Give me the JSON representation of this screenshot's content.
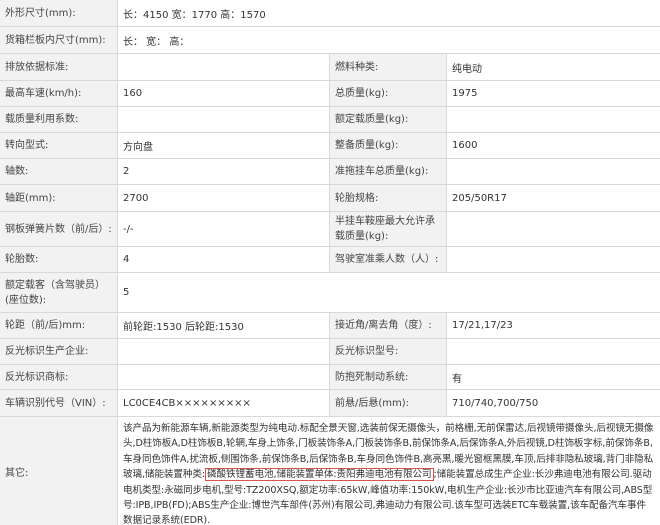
{
  "rows": [
    {
      "label": "外形尺寸(mm):",
      "value": "长：4150 宽：1770 高：1570"
    },
    {
      "label": "货箱栏板内尺寸(mm):",
      "value": "长： 宽： 高："
    },
    {
      "l1": "排放依据标准:",
      "v1": "",
      "l2": "燃料种类:",
      "v2": "纯电动"
    },
    {
      "l1": "最高车速(km/h):",
      "v1": "160",
      "l2": "总质量(kg):",
      "v2": "1975"
    },
    {
      "l1": "载质量利用系数:",
      "v1": "",
      "l2": "额定载质量(kg):",
      "v2": ""
    },
    {
      "l1": "转向型式:",
      "v1": "方向盘",
      "l2": "整备质量(kg):",
      "v2": "1600"
    },
    {
      "l1": "轴数:",
      "v1": "2",
      "l2": "准拖挂车总质量(kg):",
      "v2": ""
    },
    {
      "l1": "轴距(mm):",
      "v1": "2700",
      "l2": "轮胎规格:",
      "v2": "205/50R17"
    },
    {
      "l1": "钢板弹簧片数（前/后）:",
      "v1": "-/-",
      "l2": "半挂车鞍座最大允许承载质量(kg):",
      "v2": ""
    },
    {
      "l1": "轮胎数:",
      "v1": "4",
      "l2": "驾驶室准乘人数（人）:",
      "v2": ""
    },
    {
      "label": "额定载客（含驾驶员）(座位数):",
      "value": "5"
    },
    {
      "l1": "轮距（前/后)mm:",
      "v1": "前轮距:1530 后轮距:1530",
      "l2": "接近角/离去角（度）:",
      "v2": "17/21,17/23"
    },
    {
      "l1": "反光标识生产企业:",
      "v1": "",
      "l2": "反光标识型号:",
      "v2": ""
    },
    {
      "l1": "反光标识商标:",
      "v1": "",
      "l2": "防抱死制动系统:",
      "v2": "有"
    },
    {
      "l1": "车辆识别代号（VIN）:",
      "v1": "LC0CE4CB×××××××××",
      "l2": "前悬/后悬(mm):",
      "v2": "710/740,700/750"
    }
  ],
  "other": {
    "label": "其它:",
    "text_before": "该产品为新能源车辆,新能源类型为纯电动.标配全景天窗,选装前保无摄像头，前格栅,无前保雷达,后视镜带摄像头,后视镜无摄像头,D柱饰板A,D柱饰板B,轮辋,车身上饰条,门板装饰条A,门板装饰条B,前保饰条A,后保饰条A,外后视镜,D柱饰板字标,前保饰条B,车身同色饰件A,扰流板,侧围饰条,前保饰条B,后保饰条B,车身同色饰件B,高亮黑,暖光窗框黑膜,车顶,后排非隐私玻璃,背门非隐私玻璃,储能装置种类:",
    "text_highlight": "磷酸铁锂蓄电池,储能装置单体:贵阳弗迪电池有限公司",
    "text_after": ";储能装置总成生产企业:长沙弗迪电池有限公司.驱动电机类型:永磁同步电机,型号:TZ200XSQ,额定功率:65kW,峰值功率:150kW,电机生产企业:长沙市比亚迪汽车有限公司,ABS型号:IPB,IPB(FD);ABS生产企业:博世汽车部件(苏州)有限公司,弗迪动力有限公司.该车型可选装ETC车载装置,该车配备汽车事件数据记录系统(EDR).",
    "highlight_color": "#d9534f"
  }
}
